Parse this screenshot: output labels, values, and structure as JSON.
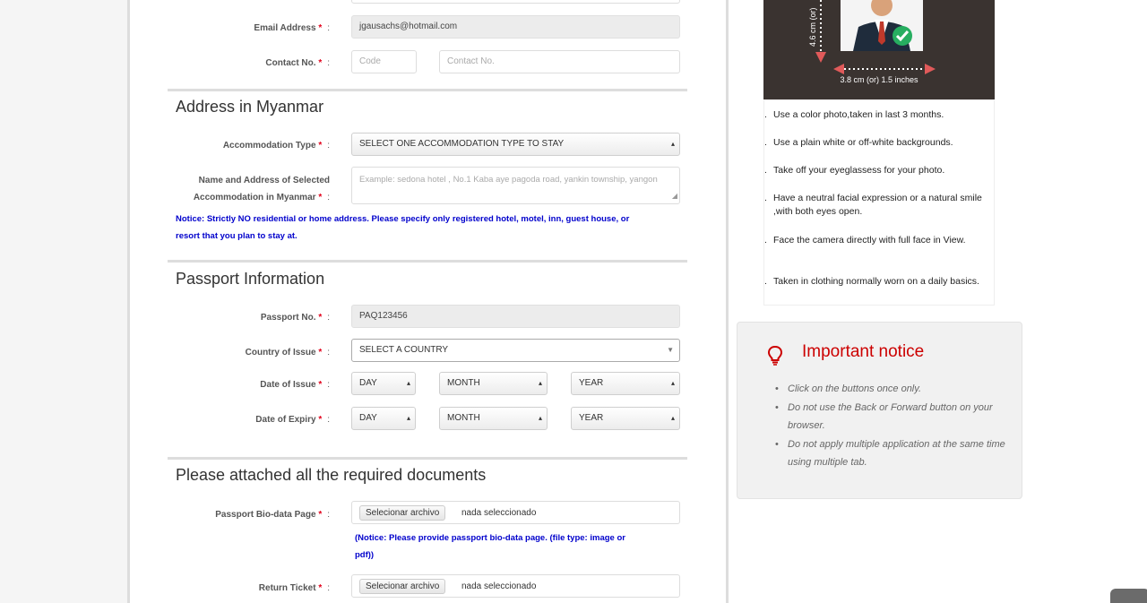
{
  "contact": {
    "email_label": "Email Address",
    "email_value": "jgausachs@hotmail.com",
    "contact_label": "Contact No.",
    "code_placeholder": "Code",
    "contact_placeholder": "Contact No."
  },
  "address": {
    "title": "Address in Myanmar",
    "accommodation_type_label": "Accommodation Type",
    "accommodation_type_value": "SELECT ONE ACCOMMODATION TYPE TO STAY",
    "name_address_label_1": "Name and Address of Selected",
    "name_address_label_2": "Accommodation in Myanmar",
    "name_address_placeholder": "Example: sedona hotel , No.1 Kaba aye pagoda road, yankin township, yangon",
    "notice_line1": "Notice: Strictly NO residential or home address. Please specify only registered hotel, motel, inn, guest house, or",
    "notice_line2": "resort that you plan to stay at."
  },
  "passport": {
    "title": "Passport Information",
    "passport_no_label": "Passport No.",
    "passport_no_value": "PAQ123456",
    "country_label": "Country of Issue",
    "country_value": "SELECT A COUNTRY",
    "issue_label": "Date of Issue",
    "expiry_label": "Date of Expiry",
    "day": "DAY",
    "month": "MONTH",
    "year": "YEAR"
  },
  "documents": {
    "title": "Please attached all the required documents",
    "biodata_label": "Passport Bio-data Page",
    "choose_file": "Selecionar archivo",
    "no_file": "nada seleccionado",
    "biodata_notice_1": "(Notice: Please provide passport bio-data page. (file type: image or",
    "biodata_notice_2": "pdf))",
    "return_label": "Return Ticket"
  },
  "common": {
    "required_mark": "*",
    "colon": ":"
  },
  "photo": {
    "height_label": "4.6 cm (or)",
    "width_label": "3.8 cm (or) 1.5 inches",
    "rules": [
      "Use a color photo,taken in last 3 months.",
      "Use a plain white or off-white backgrounds.",
      "Take off your eyeglassess for your photo.",
      "Have a neutral facial expression or a natural smile ,with both  eyes open.",
      "Face the camera directly with full face in View.",
      "Taken in clothing normally worn on a daily basics."
    ]
  },
  "notice": {
    "title": "Important notice",
    "items": [
      "Click on the buttons once only.",
      "Do not use the Back or Forward button on your browser.",
      "Do not apply multiple application at the same time using multiple tab."
    ]
  },
  "colors": {
    "required": "#e2001a",
    "notice_blue": "#0000cc",
    "notice_red": "#cc0000"
  }
}
